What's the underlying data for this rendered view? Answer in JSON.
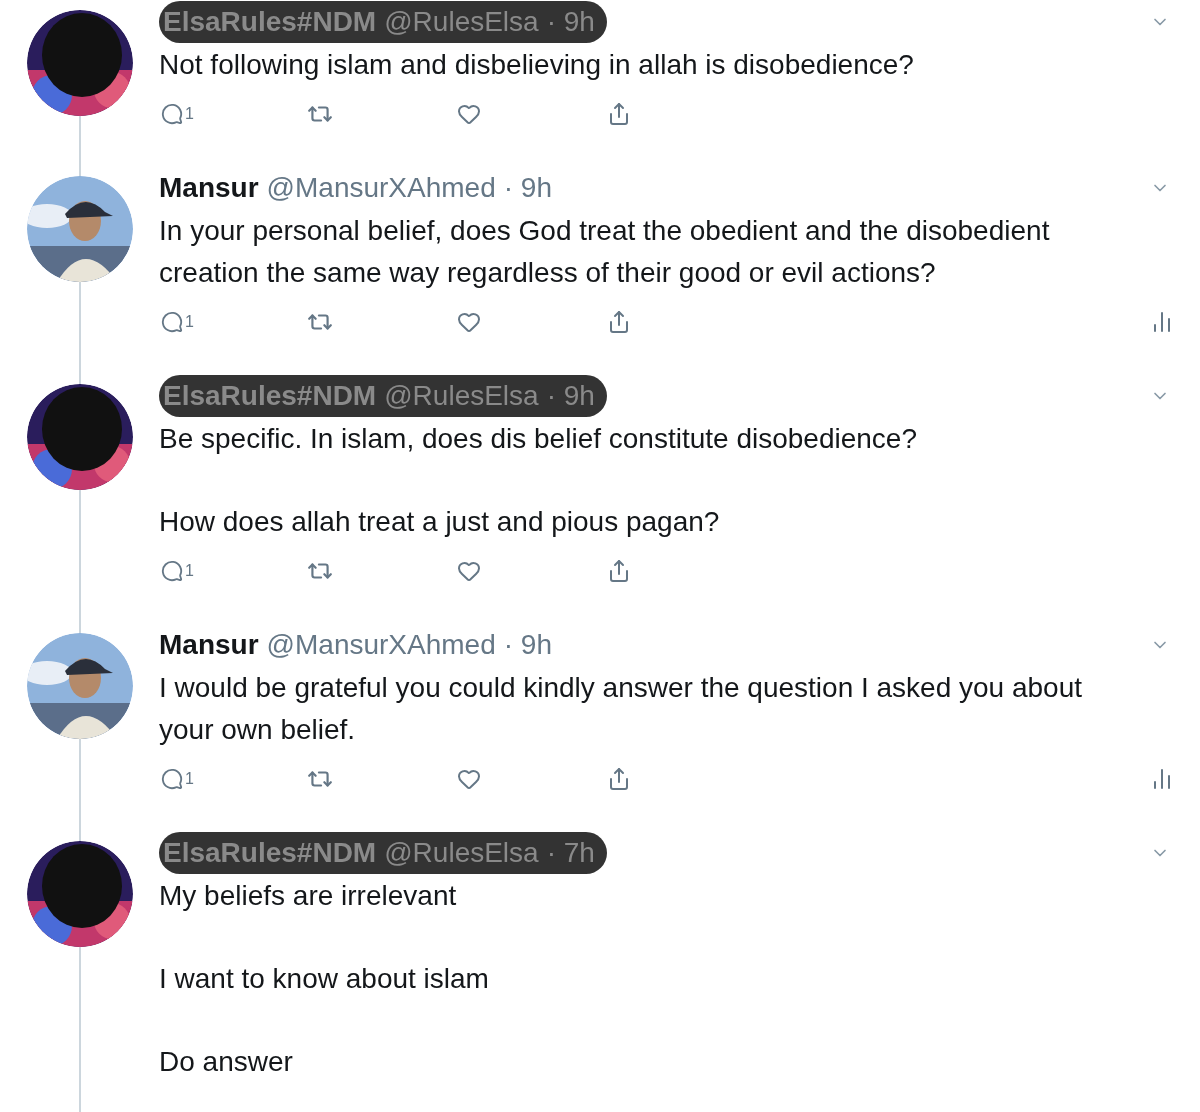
{
  "tweets": [
    {
      "name": "ElsaRules#NDM",
      "handle": "@RulesElsa",
      "time": "· 9h",
      "redacted": true,
      "paragraphs": [
        "Not following islam and disbelieving in allah is disobedience?"
      ],
      "actions": {
        "replies": "1",
        "analytics": false
      }
    },
    {
      "name": "Mansur",
      "handle": "@MansurXAhmed",
      "time": "· 9h",
      "redacted": false,
      "paragraphs": [
        "In your personal belief, does God treat the obedient and the disobedient creation the same way regardless of their good or evil actions?"
      ],
      "actions": {
        "replies": "1",
        "analytics": true
      }
    },
    {
      "name": "ElsaRules#NDM",
      "handle": "@RulesElsa",
      "time": "· 9h",
      "redacted": true,
      "paragraphs": [
        "Be specific. In islam, does dis belief constitute disobedience?",
        "How does allah treat a just and pious pagan?"
      ],
      "actions": {
        "replies": "1",
        "analytics": false
      }
    },
    {
      "name": "Mansur",
      "handle": "@MansurXAhmed",
      "time": "· 9h",
      "redacted": false,
      "paragraphs": [
        "I would be grateful you could kindly answer the question I asked you about your own belief."
      ],
      "actions": {
        "replies": "1",
        "analytics": true
      }
    },
    {
      "name": "ElsaRules#NDM",
      "handle": "@RulesElsa",
      "time": "· 7h",
      "redacted": true,
      "paragraphs": [
        "My beliefs are irrelevant",
        "I want to know about islam",
        "Do answer"
      ]
    }
  ]
}
